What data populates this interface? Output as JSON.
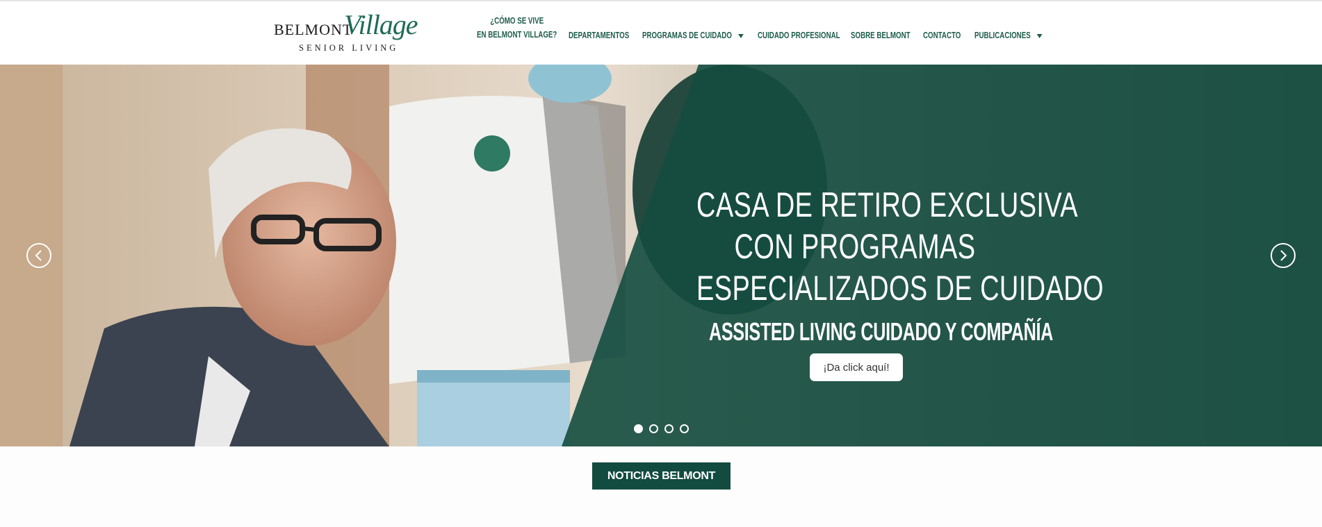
{
  "brand": {
    "word1": "BELMONT",
    "word2": "Village",
    "tagline": "SENIOR LIVING"
  },
  "nav": {
    "items": [
      {
        "label_line1": "¿CÓMO SE VIVE",
        "label_line2": "EN BELMONT VILLAGE?"
      },
      {
        "label": "DEPARTAMENTOS"
      },
      {
        "label": "PROGRAMAS DE CUIDADO",
        "dropdown": true
      },
      {
        "label": "CUIDADO PROFESIONAL"
      },
      {
        "label": "SOBRE BELMONT"
      },
      {
        "label": "CONTACTO"
      },
      {
        "label": "PUBLICACIONES",
        "dropdown": true
      }
    ]
  },
  "hero": {
    "title_lines": [
      "CASA DE RETIRO EXCLUSIVA",
      "CON PROGRAMAS",
      "ESPECIALIZADOS DE CUIDADO"
    ],
    "subtitle": "ASSISTED LIVING CUIDADO Y COMPAÑÍA",
    "cta": "¡Da click aquí!",
    "slides_total": 4,
    "active_slide": 1
  },
  "news_button": "NOTICIAS BELMONT",
  "colors": {
    "brand_green": "#1e6a56",
    "nav_text": "#1e5c4b",
    "overlay_green": "#144c3f",
    "news_bg": "#124b3f"
  }
}
